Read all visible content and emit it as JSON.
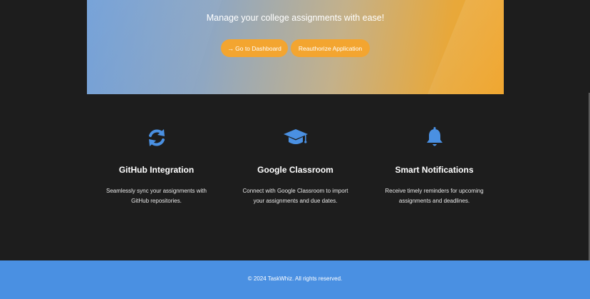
{
  "hero": {
    "tagline": "Manage your college assignments with ease!",
    "buttons": {
      "dashboard_label": "Go to Dashboard",
      "dashboard_icon": "arrow-right-icon",
      "reauthorize_label": "Reauthorize Application"
    }
  },
  "features": [
    {
      "icon": "sync-icon",
      "title": "GitHub Integration",
      "description": "Seamlessly sync your assignments with GitHub repositories."
    },
    {
      "icon": "graduation-cap-icon",
      "title": "Google Classroom",
      "description": "Connect with Google Classroom to import your assignments and due dates."
    },
    {
      "icon": "bell-icon",
      "title": "Smart Notifications",
      "description": "Receive timely reminders for upcoming assignments and deadlines."
    }
  ],
  "footer": {
    "copyright": "© 2024 TaskWhiz. All rights reserved."
  },
  "colors": {
    "accent_blue": "#4a90e2",
    "button_orange": "#f3a530",
    "background": "#1d1d1d"
  }
}
